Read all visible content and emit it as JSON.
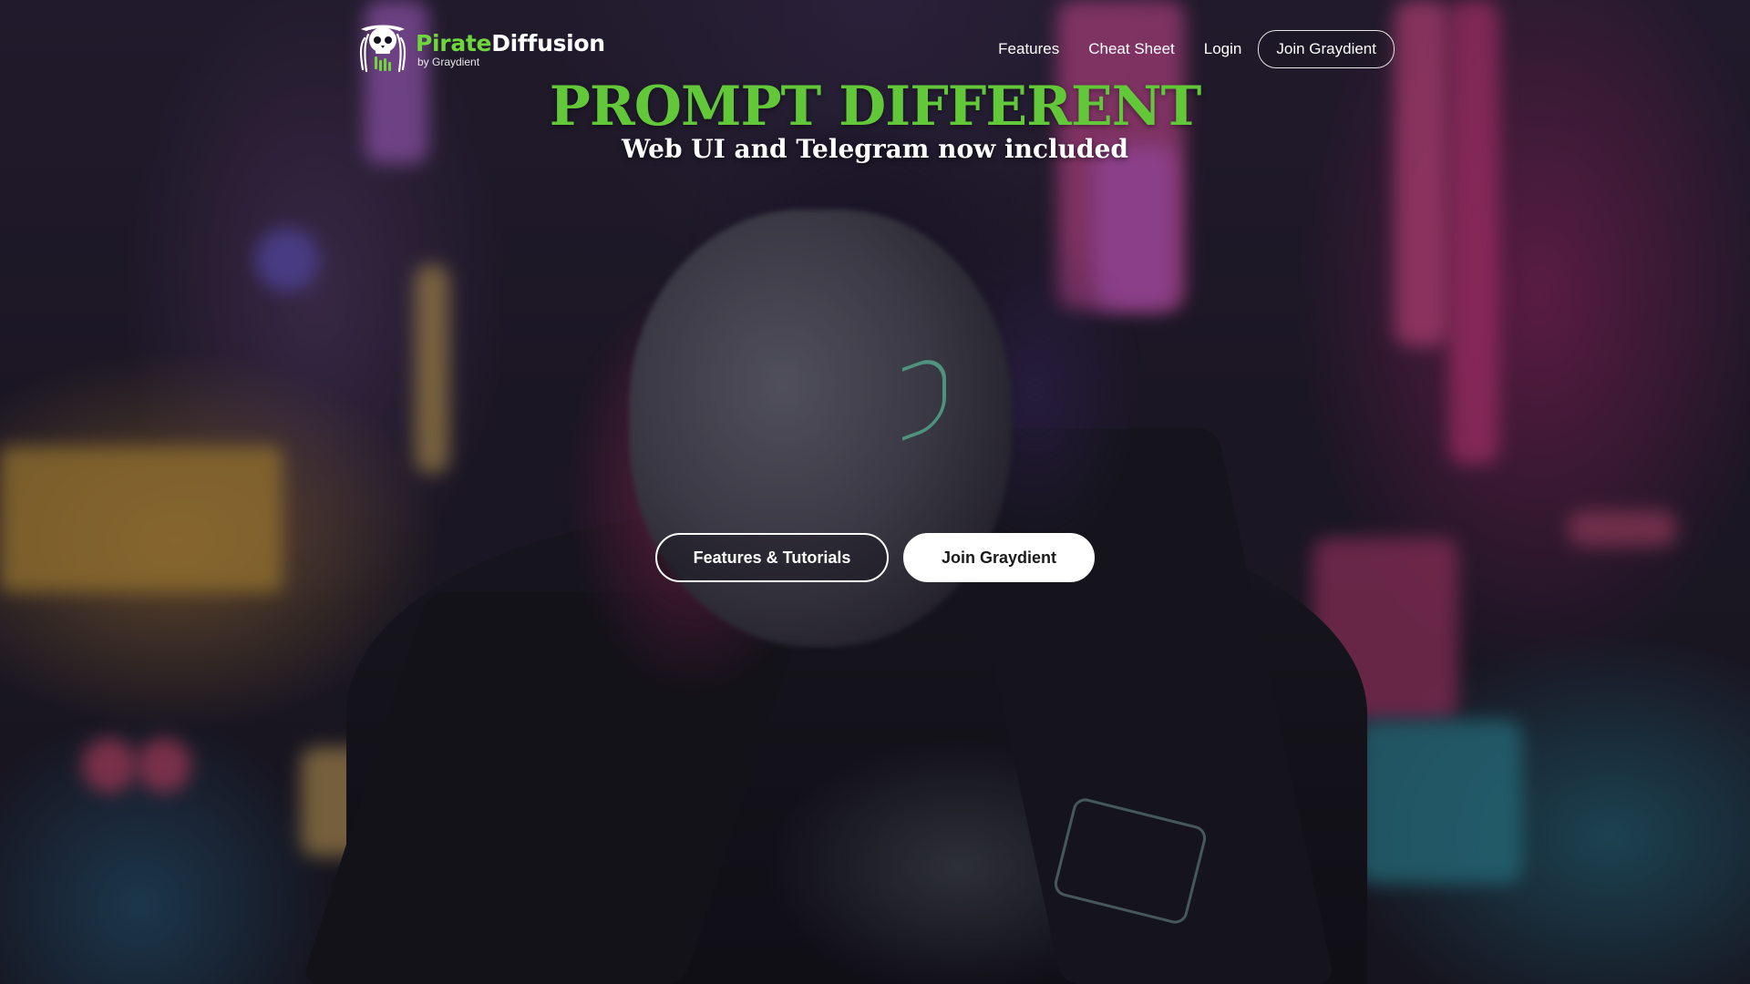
{
  "brand": {
    "name_part1": "Pirate",
    "name_part2": "Diffusion",
    "byline": "by Graydient",
    "logo_icon": "pirate-skull-icon"
  },
  "nav": {
    "items": [
      {
        "label": "Features"
      },
      {
        "label": "Cheat Sheet"
      },
      {
        "label": "Login"
      }
    ],
    "cta_label": "Join Graydient"
  },
  "hero": {
    "title": "PROMPT DIFFERENT",
    "subtitle": "Web UI and Telegram now included",
    "buttons": {
      "primary_label": "Features & Tutorials",
      "secondary_label": "Join Graydient"
    }
  },
  "colors": {
    "accent_green": "#62c83a",
    "brand_green": "#6fd63c",
    "text_white": "#ffffff"
  }
}
